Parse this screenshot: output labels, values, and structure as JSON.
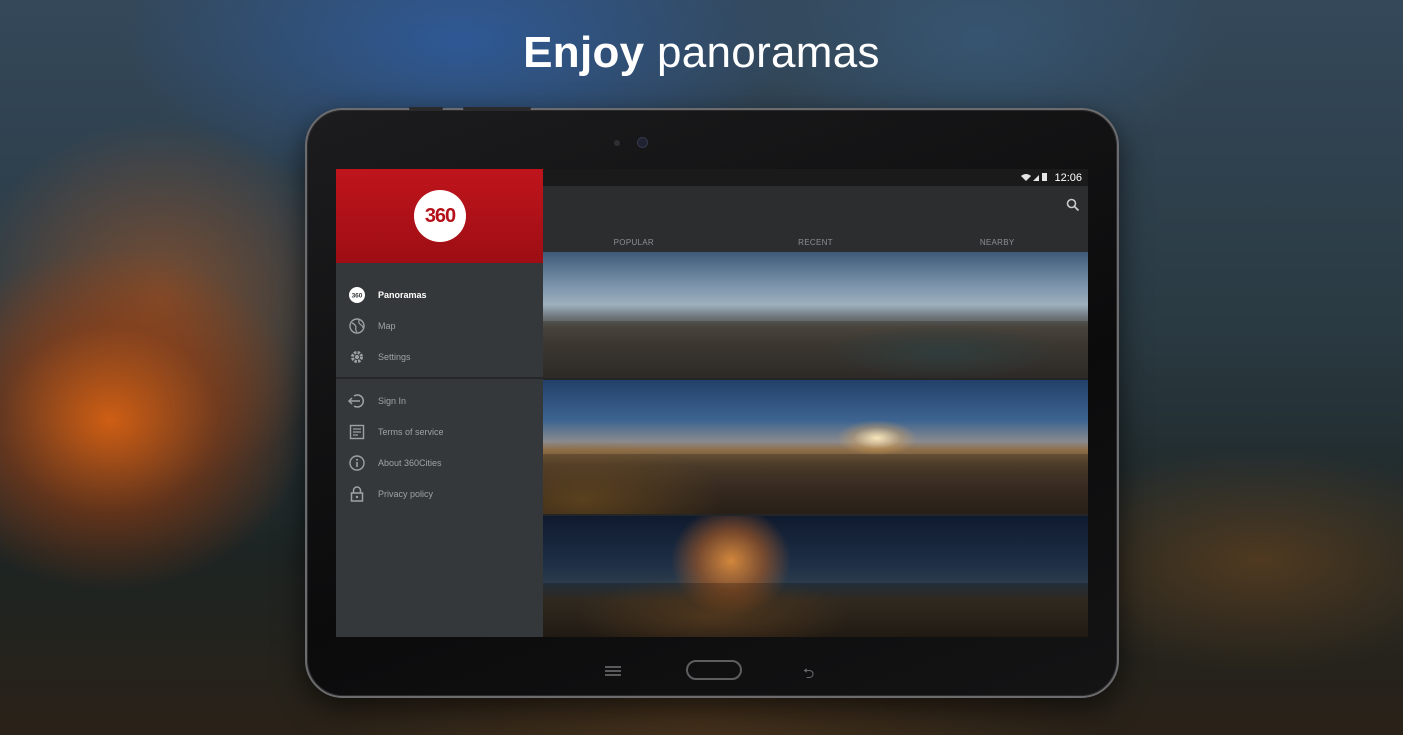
{
  "headline": {
    "bold": "Enjoy",
    "light": "panoramas"
  },
  "status_bar": {
    "icons": "wifi-icon signal-icon battery-icon",
    "time": "12:06"
  },
  "app": {
    "logo_text": "360"
  },
  "tabs": [
    {
      "label": "POPULAR"
    },
    {
      "label": "RECENT"
    },
    {
      "label": "NEARBY"
    }
  ],
  "drawer": {
    "primary": [
      {
        "label": "Panoramas",
        "icon": "360-icon",
        "active": true
      },
      {
        "label": "Map",
        "icon": "globe-icon",
        "active": false
      },
      {
        "label": "Settings",
        "icon": "gear-icon",
        "active": false
      }
    ],
    "secondary": [
      {
        "label": "Sign In",
        "icon": "sign-in-icon"
      },
      {
        "label": "Terms of service",
        "icon": "document-icon"
      },
      {
        "label": "About 360Cities",
        "icon": "info-icon"
      },
      {
        "label": "Privacy policy",
        "icon": "lock-icon"
      }
    ]
  },
  "colors": {
    "accent_red": "#c0141c",
    "drawer_bg": "#35383a",
    "app_bar_bg": "#2b2d2f"
  }
}
